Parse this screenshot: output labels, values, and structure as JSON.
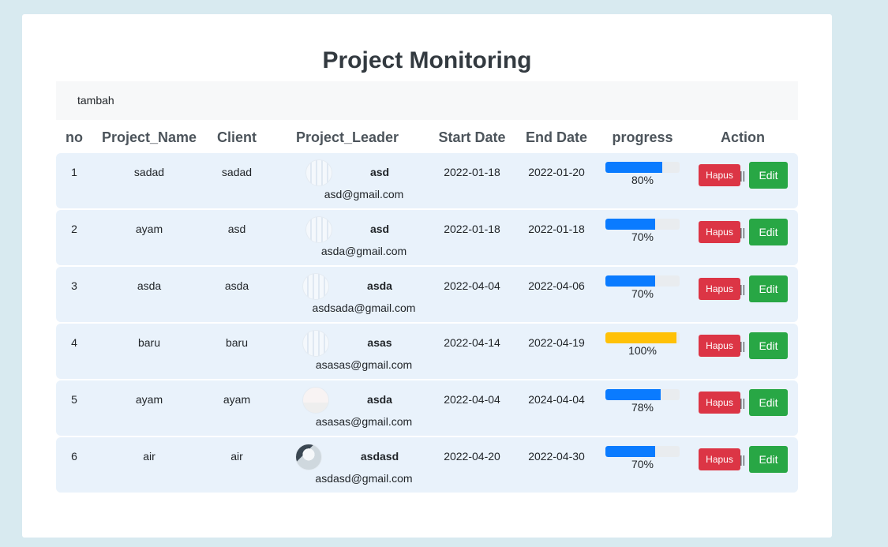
{
  "page": {
    "title": "Project Monitoring",
    "add_link": "tambah"
  },
  "table": {
    "headers": [
      "no",
      "Project_Name",
      "Client",
      "Project_Leader",
      "Start Date",
      "End Date",
      "progress",
      "Action"
    ],
    "delete_label": "Hapus",
    "separator": "||",
    "edit_label": "Edit",
    "rows": [
      {
        "no": "1",
        "name": "sadad",
        "client": "sadad",
        "leader": "asd",
        "email": "asd@gmail.com",
        "start": "2022-01-18",
        "end": "2022-01-20",
        "progress_label": "80%",
        "progress": 0.8,
        "bar_color": "#0a7bff"
      },
      {
        "no": "2",
        "name": "ayam",
        "client": "asd",
        "leader": "asd",
        "email": "asda@gmail.com",
        "start": "2022-01-18",
        "end": "2022-01-18",
        "progress_label": "70%",
        "progress": 0.7,
        "bar_color": "#0a7bff"
      },
      {
        "no": "3",
        "name": "asda",
        "client": "asda",
        "leader": "asda",
        "email": "asdsada@gmail.com",
        "start": "2022-04-04",
        "end": "2022-04-06",
        "progress_label": "70%",
        "progress": 0.7,
        "bar_color": "#0a7bff"
      },
      {
        "no": "4",
        "name": "baru",
        "client": "baru",
        "leader": "asas",
        "email": "asasas@gmail.com",
        "start": "2022-04-14",
        "end": "2022-04-19",
        "progress_label": "100%",
        "progress": 1.0,
        "bar_color": "#ffc107"
      },
      {
        "no": "5",
        "name": "ayam",
        "client": "ayam",
        "leader": "asda",
        "email": "asasas@gmail.com",
        "start": "2022-04-04",
        "end": "2024-04-04",
        "progress_label": "78%",
        "progress": 0.78,
        "bar_color": "#0a7bff"
      },
      {
        "no": "6",
        "name": "air",
        "client": "air",
        "leader": "asdasd",
        "email": "asdasd@gmail.com",
        "start": "2022-04-20",
        "end": "2022-04-30",
        "progress_label": "70%",
        "progress": 0.7,
        "bar_color": "#0a7bff"
      }
    ]
  }
}
